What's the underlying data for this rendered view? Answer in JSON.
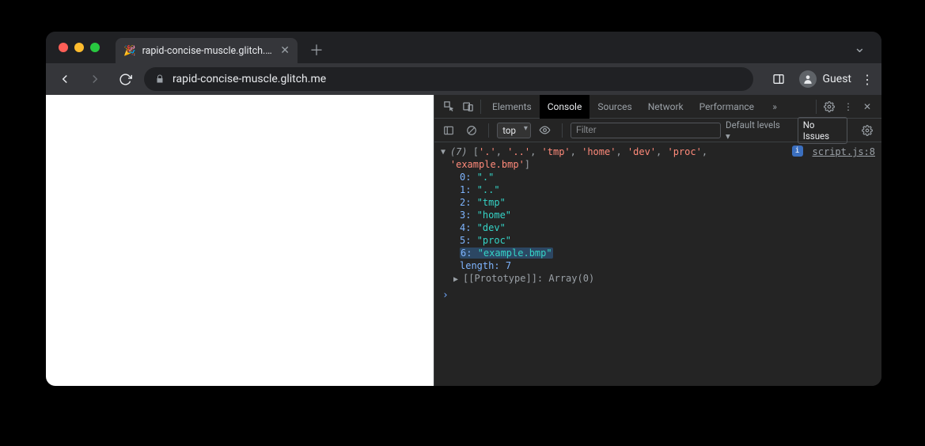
{
  "browser": {
    "tab_title": "rapid-concise-muscle.glitch.me",
    "url": "rapid-concise-muscle.glitch.me",
    "guest_label": "Guest"
  },
  "devtools": {
    "tabs": [
      "Elements",
      "Console",
      "Sources",
      "Network",
      "Performance"
    ],
    "active_tab": "Console",
    "context": "top",
    "filter_placeholder": "Filter",
    "levels_label": "Default levels ▾",
    "issues_label": "No Issues",
    "source_link": "script.js:8"
  },
  "console": {
    "array": {
      "count": 7,
      "summary_items": [
        ".",
        "..",
        "tmp",
        "home",
        "dev",
        "proc",
        "example.bmp"
      ],
      "entries": [
        {
          "index": 0,
          "value": "."
        },
        {
          "index": 1,
          "value": ".."
        },
        {
          "index": 2,
          "value": "tmp"
        },
        {
          "index": 3,
          "value": "home"
        },
        {
          "index": 4,
          "value": "dev"
        },
        {
          "index": 5,
          "value": "proc"
        },
        {
          "index": 6,
          "value": "example.bmp",
          "highlighted": true
        }
      ],
      "length_label": "length",
      "length_value": 7,
      "prototype_label": "[[Prototype]]",
      "prototype_value": "Array(0)"
    }
  }
}
